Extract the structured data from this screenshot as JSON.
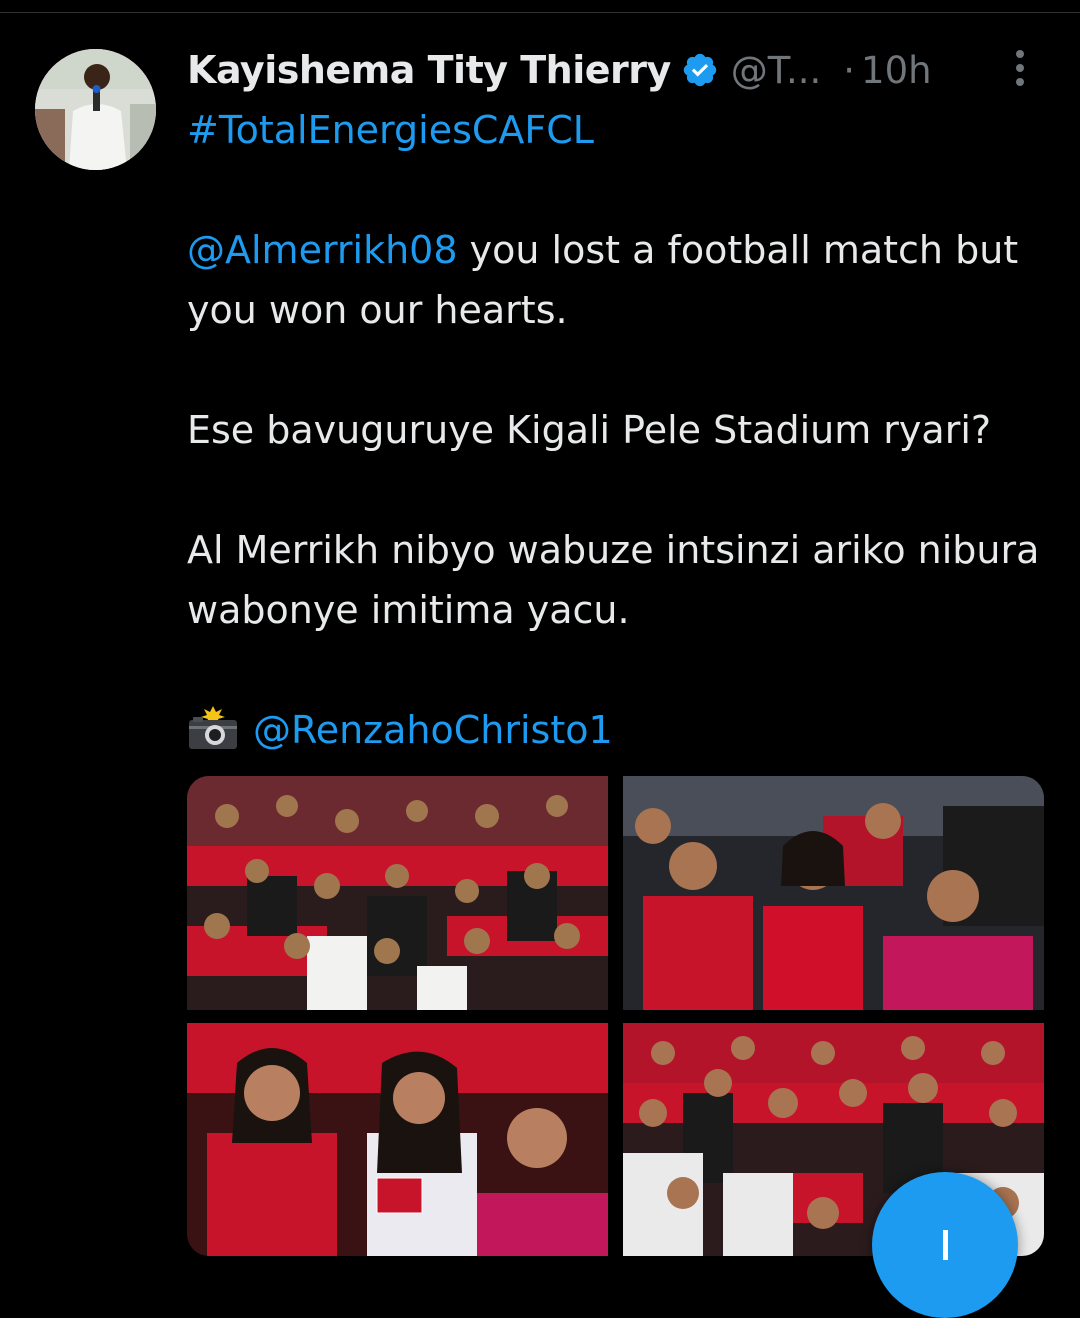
{
  "tweet": {
    "author": {
      "name": "Kayishema Tity Thierry",
      "verified": true,
      "handle": "@T...",
      "separator": "·",
      "time": "10h",
      "avatar_icon": "avatar-photo"
    },
    "hashtag": "#TotalEnergiesCAFCL",
    "line1_mention": "@Almerrikh08",
    "line1_text": " you lost a football match but you won our hearts.",
    "paragraph2": "Ese bavuguruye Kigali Pele Stadium ryari?",
    "paragraph3": "Al Merrikh nibyo wabuze intsinzi ariko nibura wabonye imitima yacu.",
    "credit_icon": "camera-flash-icon",
    "credit_mention": "@RenzahoChristo1",
    "media": [
      {
        "alt": "stadium-crowd-photo-1"
      },
      {
        "alt": "stadium-crowd-photo-2"
      },
      {
        "alt": "stadium-crowd-photo-3"
      },
      {
        "alt": "stadium-crowd-photo-4"
      }
    ]
  },
  "compose_fab": {
    "icon": "plus-icon"
  },
  "colors": {
    "background": "#000000",
    "text": "#e7e9ea",
    "muted": "#71767b",
    "link": "#1d9bf0",
    "crowd_red": "#c8142a"
  }
}
